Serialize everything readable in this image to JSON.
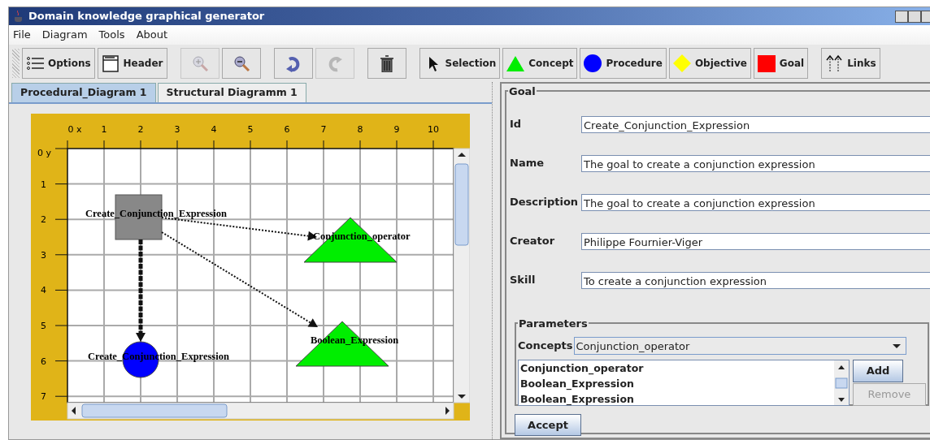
{
  "window": {
    "title": "Domain knowledge graphical generator"
  },
  "menu": [
    {
      "label": "File"
    },
    {
      "label": "Diagram"
    },
    {
      "label": "Tools"
    },
    {
      "label": "About"
    }
  ],
  "toolbar": [
    {
      "kind": "options",
      "label": "Options",
      "disabled": false
    },
    {
      "kind": "header",
      "label": "Header",
      "disabled": false
    },
    {
      "kind": "zoom-in",
      "disabled": true
    },
    {
      "kind": "zoom-out",
      "disabled": false
    },
    {
      "kind": "undo",
      "disabled": false
    },
    {
      "kind": "redo",
      "disabled": true
    },
    {
      "kind": "delete",
      "disabled": false
    },
    {
      "kind": "selection",
      "label": "Selection",
      "disabled": false
    },
    {
      "kind": "concept",
      "label": "Concept",
      "disabled": false
    },
    {
      "kind": "procedure",
      "label": "Procedure",
      "disabled": false
    },
    {
      "kind": "objective",
      "label": "Objective",
      "disabled": false
    },
    {
      "kind": "goal",
      "label": "Goal",
      "disabled": false
    },
    {
      "kind": "links",
      "label": "Links",
      "disabled": false
    }
  ],
  "tabs": [
    {
      "label": "Procedural_Diagram 1",
      "selected": true
    },
    {
      "label": "Structural Diagramm 1",
      "selected": false
    }
  ],
  "diagram": {
    "x_ruler": [
      "0 x",
      "1",
      "2",
      "3",
      "4",
      "5",
      "6",
      "7",
      "8",
      "9",
      "10"
    ],
    "y_ruler": [
      "0 y",
      "1",
      "2",
      "3",
      "4",
      "5",
      "6",
      "7"
    ],
    "nodes": [
      {
        "kind": "goal",
        "label": "Create_Conjunction_Expression"
      },
      {
        "kind": "procedure",
        "label": "Create_Conjunction_Expression"
      },
      {
        "kind": "concept",
        "label": "Conjunction_operator"
      },
      {
        "kind": "concept",
        "label": "Boolean_Expression"
      }
    ],
    "links": [
      {
        "kind": "dotted"
      },
      {
        "kind": "dotted"
      },
      {
        "kind": "dashed"
      }
    ]
  },
  "form": {
    "legend": "Goal",
    "fields": [
      {
        "label": "Id",
        "value": "Create_Conjunction_Expression"
      },
      {
        "label": "Name",
        "value": "The goal to create a conjunction expression"
      },
      {
        "label": "Description",
        "value": "The goal to create a conjunction expression"
      },
      {
        "label": "Creator",
        "value": "Philippe Fournier-Viger"
      },
      {
        "label": "Skill",
        "value": "To create a conjunction expression"
      }
    ],
    "parameters": {
      "legend": "Parameters",
      "concepts_label": "Concepts",
      "concepts_value": "Conjunction_operator",
      "list": [
        "Conjunction_operator",
        "Boolean_Expression",
        "Boolean_Expression"
      ],
      "buttons": [
        {
          "label": "Add",
          "disabled": false
        },
        {
          "label": "Remove",
          "disabled": true
        }
      ]
    },
    "accept": {
      "label": "Accept"
    }
  }
}
